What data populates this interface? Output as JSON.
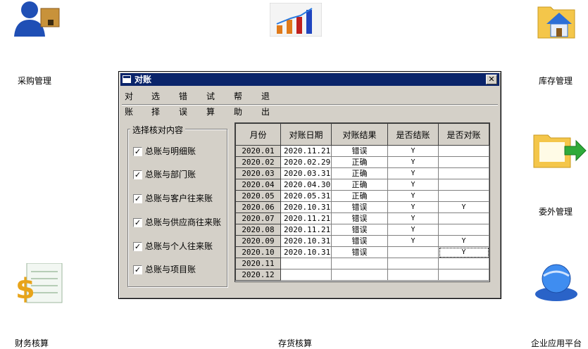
{
  "desktop": {
    "icons": [
      {
        "label": "采购管理"
      },
      {
        "label": ""
      },
      {
        "label": "库存管理"
      },
      {
        "label": "委外管理"
      },
      {
        "label": "财务核算"
      },
      {
        "label": "存货核算"
      },
      {
        "label": "企业应用平台"
      }
    ]
  },
  "dialog": {
    "title": "对账",
    "close_label": "✕",
    "menu": [
      "对账",
      "选择",
      "错误",
      "试算",
      "帮助",
      "退出"
    ],
    "group_title": "选择核对内容",
    "options": [
      {
        "label": "总账与明细账",
        "checked": true
      },
      {
        "label": "总账与部门账",
        "checked": true
      },
      {
        "label": "总账与客户往来账",
        "checked": true
      },
      {
        "label": "总账与供应商往来账",
        "checked": true
      },
      {
        "label": "总账与个人往来账",
        "checked": true
      },
      {
        "label": "总账与项目账",
        "checked": true
      }
    ],
    "check_mark": "✓",
    "grid": {
      "headers": [
        "月份",
        "对账日期",
        "对账结果",
        "是否结账",
        "是否对账"
      ],
      "rows": [
        [
          "2020.01",
          "2020.11.21",
          "错误",
          "Y",
          ""
        ],
        [
          "2020.02",
          "2020.02.29",
          "正确",
          "Y",
          ""
        ],
        [
          "2020.03",
          "2020.03.31",
          "正确",
          "Y",
          ""
        ],
        [
          "2020.04",
          "2020.04.30",
          "正确",
          "Y",
          ""
        ],
        [
          "2020.05",
          "2020.05.31",
          "正确",
          "Y",
          ""
        ],
        [
          "2020.06",
          "2020.10.31",
          "错误",
          "Y",
          "Y"
        ],
        [
          "2020.07",
          "2020.11.21",
          "错误",
          "Y",
          ""
        ],
        [
          "2020.08",
          "2020.11.21",
          "错误",
          "Y",
          ""
        ],
        [
          "2020.09",
          "2020.10.31",
          "错误",
          "Y",
          "Y"
        ],
        [
          "2020.10",
          "2020.10.31",
          "错误",
          "",
          "Y"
        ],
        [
          "2020.11",
          "",
          "",
          "",
          ""
        ],
        [
          "2020.12",
          "",
          "",
          "",
          ""
        ]
      ]
    }
  },
  "colors": {
    "titlebar": "#0a246a",
    "face": "#d4d0c8"
  }
}
